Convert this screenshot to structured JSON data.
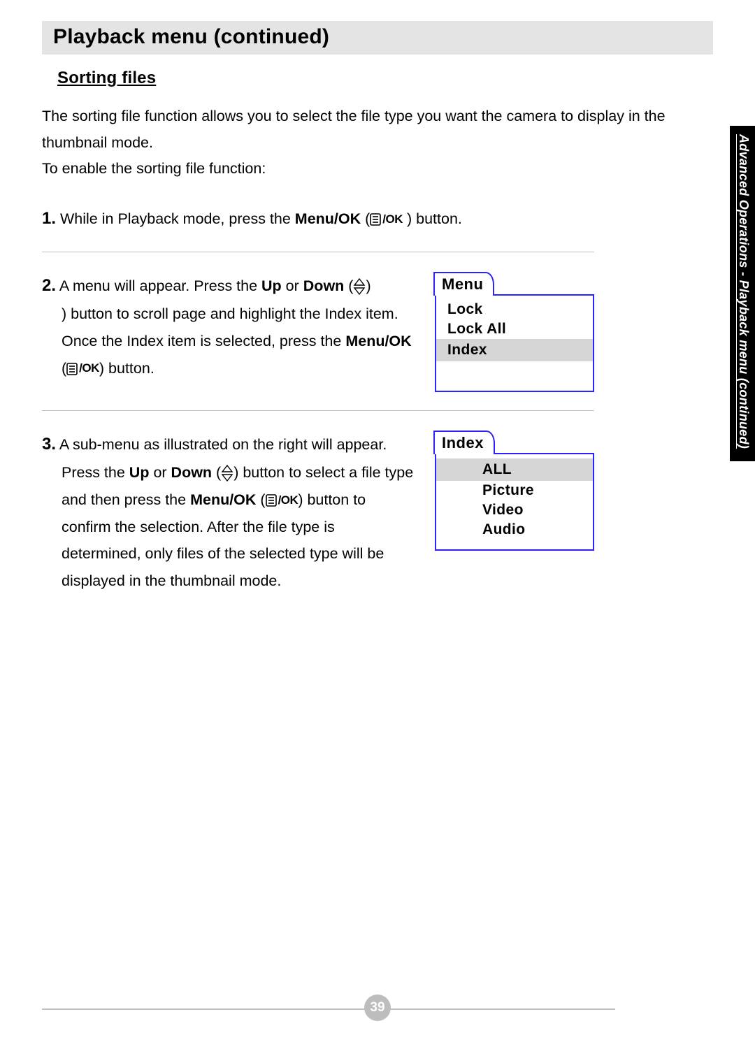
{
  "header": {
    "title": "Playback menu (continued)",
    "side_tab": "Advanced Operations - Playback menu (continued)"
  },
  "section": {
    "heading": "Sorting files",
    "intro_line1": "The sorting file function allows you to select the file type you want the camera to display in the thumbnail mode.",
    "intro_line2": "To enable the sorting file function:"
  },
  "steps": {
    "s1": {
      "num": "1.",
      "a": "While in Playback mode, press the ",
      "b_bold": "Menu/OK",
      "c": " (",
      "d": " ) button."
    },
    "s2": {
      "num": "2.",
      "a": "A menu will appear. Press the ",
      "b_bold": "Up",
      "c": " or ",
      "d_bold": "Down",
      "e": " (",
      "f": ") button to scroll page and highlight the Index item. Once the Index item is selected, press the ",
      "g_bold": "Menu/OK",
      "h": " (",
      "i": ") button."
    },
    "s3": {
      "num": "3.",
      "a": "A sub-menu as illustrated on the right will appear. Press the ",
      "b_bold": "Up",
      "c": " or ",
      "d_bold": "Down",
      "e": " (",
      "f": ") button to select a file type and then press the ",
      "g_bold": "Menu/OK",
      "h": " (",
      "i": ") button to confirm the selection. After the file type is determined, only files of the selected type will be displayed in the thumbnail mode."
    }
  },
  "mock1": {
    "tab": "Menu",
    "items": {
      "i0": "Lock",
      "i1": "Lock All",
      "i2": "Index"
    }
  },
  "mock2": {
    "tab": "Index",
    "items": {
      "i0": "ALL",
      "i1": "Picture",
      "i2": "Video",
      "i3": "Audio"
    }
  },
  "glyph": {
    "ok": "/OK"
  },
  "page_number": "39"
}
